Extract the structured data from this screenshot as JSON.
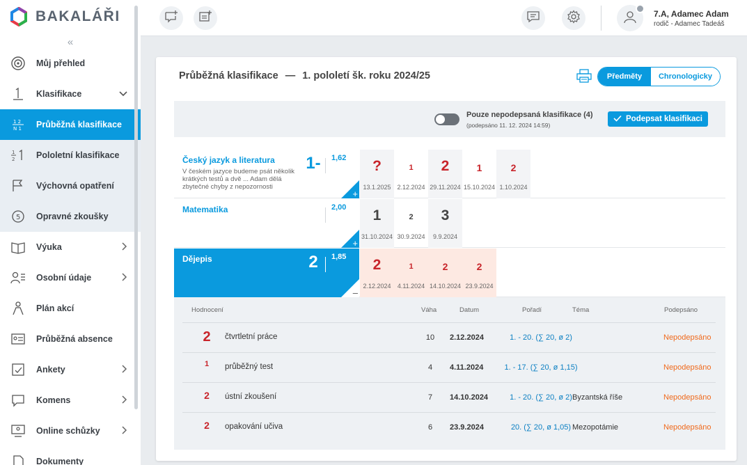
{
  "app": {
    "name": "BAKALÁŘI"
  },
  "sidebar": {
    "collapse_glyph": "«",
    "items": [
      {
        "label": "Můj přehled",
        "icon": "overview-icon"
      },
      {
        "label": "Klasifikace",
        "icon": "grade-icon",
        "expanded": true
      },
      {
        "label": "Průběžná klasifikace",
        "icon": "ongoing-grades-icon",
        "active": true
      },
      {
        "label": "Pololetní klasifikace",
        "icon": "semester-grades-icon"
      },
      {
        "label": "Výchovná opatření",
        "icon": "measures-icon"
      },
      {
        "label": "Opravné zkoušky",
        "icon": "retake-exam-icon"
      },
      {
        "label": "Výuka",
        "icon": "teaching-icon"
      },
      {
        "label": "Osobní údaje",
        "icon": "personal-data-icon"
      },
      {
        "label": "Plán akcí",
        "icon": "events-plan-icon"
      },
      {
        "label": "Průběžná absence",
        "icon": "absence-icon"
      },
      {
        "label": "Ankety",
        "icon": "survey-icon"
      },
      {
        "label": "Komens",
        "icon": "messages-icon"
      },
      {
        "label": "Online schůzky",
        "icon": "online-meeting-icon"
      },
      {
        "label": "Dokumenty",
        "icon": "documents-icon"
      }
    ]
  },
  "user": {
    "name": "7.A, Adamec Adam",
    "role": "rodič - Adamec Tadeáš"
  },
  "page": {
    "title": "Průběžná klasifikace",
    "dash": "—",
    "period": "1. pololetí šk. roku 2024/25",
    "view_subjects": "Předměty",
    "view_chrono": "Chronologicky"
  },
  "filter": {
    "label": "Pouze nepodepsaná klasifikace (4)",
    "signed_info": "(podepsáno 11. 12. 2024 14:59)",
    "sign_button": "Podepsat klasifikaci",
    "toggle_on": false
  },
  "subjects": [
    {
      "name": "Český jazyk a literatura",
      "note": "V českém jazyce budeme psát několik krátkých testů a dvě ... Adam dělá zbytečné chyby z nepozornosti",
      "avg_mark": "1-",
      "average": "1,62",
      "corner_sign": "+",
      "grades": [
        {
          "value": "?",
          "date": "13.1.2025",
          "size": "big",
          "color": "red"
        },
        {
          "value": "1",
          "date": "2.12.2024",
          "size": "small",
          "color": "red"
        },
        {
          "value": "2",
          "date": "29.11.2024",
          "size": "big",
          "color": "red"
        },
        {
          "value": "1",
          "date": "15.10.2024",
          "size": "mid",
          "color": "red"
        },
        {
          "value": "2",
          "date": "1.10.2024",
          "size": "mid",
          "color": "red"
        }
      ]
    },
    {
      "name": "Matematika",
      "note": "",
      "avg_mark": "",
      "average": "2,00",
      "corner_sign": "+",
      "grades": [
        {
          "value": "1",
          "date": "31.10.2024",
          "size": "big",
          "color": "dark"
        },
        {
          "value": "2",
          "date": "30.9.2024",
          "size": "small",
          "color": "dark"
        },
        {
          "value": "3",
          "date": "9.9.2024",
          "size": "big",
          "color": "dark"
        }
      ]
    },
    {
      "name": "Dějepis",
      "note": "",
      "avg_mark": "2",
      "average": "1,85",
      "corner_sign": "–",
      "selected": true,
      "grades": [
        {
          "value": "2",
          "date": "2.12.2024",
          "size": "big",
          "color": "red"
        },
        {
          "value": "1",
          "date": "4.11.2024",
          "size": "small",
          "color": "red"
        },
        {
          "value": "2",
          "date": "14.10.2024",
          "size": "mid",
          "color": "red"
        },
        {
          "value": "2",
          "date": "23.9.2024",
          "size": "mid",
          "color": "red"
        }
      ]
    }
  ],
  "detail": {
    "headers": {
      "grade": "Hodnocení",
      "weight": "Váha",
      "date": "Datum",
      "rank": "Pořadí",
      "topic": "Téma",
      "signed": "Podepsáno"
    },
    "rows": [
      {
        "grade": "2",
        "size": "big",
        "name": "čtvrtletní práce",
        "weight": "10",
        "date": "2.12.2024",
        "rank": "1. - 20. (∑ 20, ø 2)",
        "topic": "",
        "signed": "Nepodepsáno"
      },
      {
        "grade": "1",
        "size": "small",
        "name": "průběžný test",
        "weight": "4",
        "date": "4.11.2024",
        "rank": "1. - 17. (∑ 20, ø 1,15)",
        "topic": "",
        "signed": "Nepodepsáno"
      },
      {
        "grade": "2",
        "size": "mid",
        "name": "ústní zkoušení",
        "weight": "7",
        "date": "14.10.2024",
        "rank": "1. - 20. (∑ 20, ø 2)",
        "topic": "Byzantská říše",
        "signed": "Nepodepsáno"
      },
      {
        "grade": "2",
        "size": "mid",
        "name": "opakování učiva",
        "weight": "6",
        "date": "23.9.2024",
        "rank": "20. (∑ 20, ø 1,05)",
        "topic": "Mezopotámie",
        "signed": "Nepodepsáno"
      }
    ]
  },
  "colors": {
    "accent": "#0a9ade",
    "grade_red": "#c8242a",
    "unsigned_orange": "#f06a1c",
    "pink_cell": "#fde9e2"
  }
}
